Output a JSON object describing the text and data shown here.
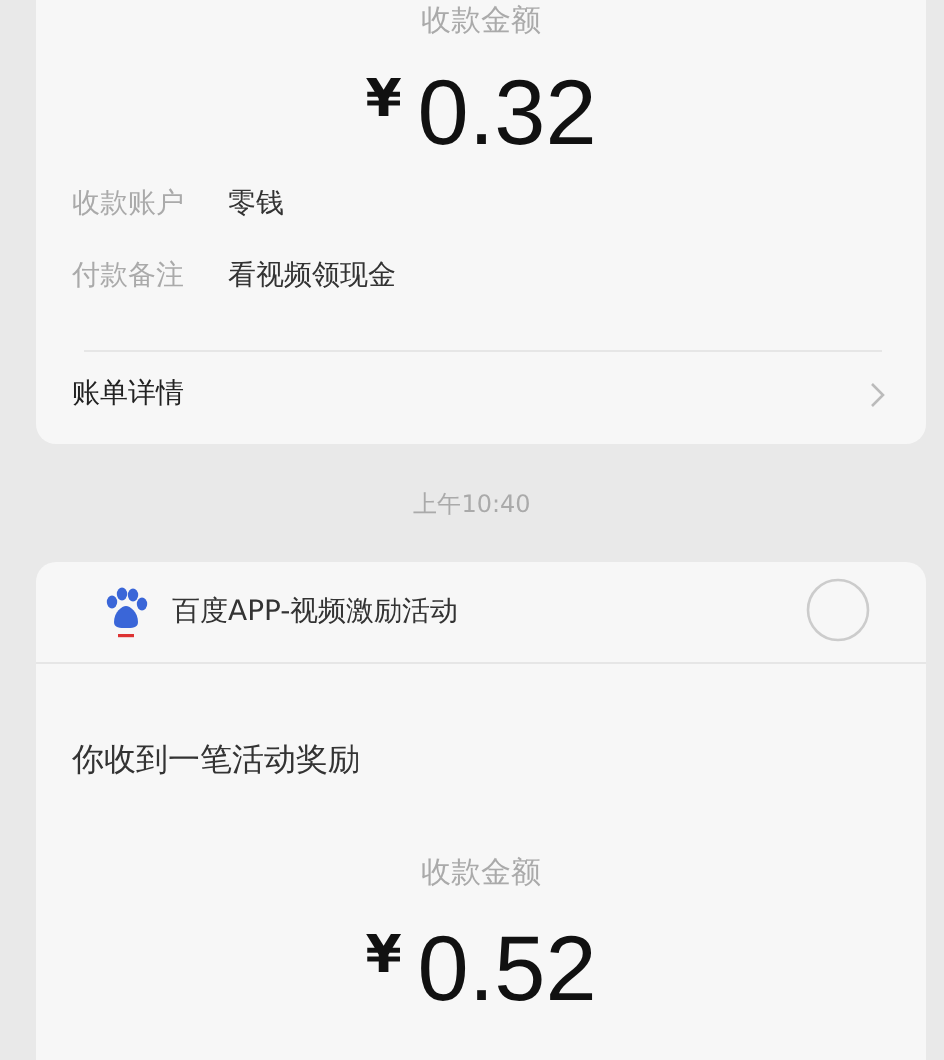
{
  "cards": [
    {
      "kind": "payment",
      "amount_label": "收款金额",
      "currency": "¥",
      "amount": "0.32",
      "details": [
        {
          "label": "收款账户",
          "value": "零钱"
        },
        {
          "label": "付款备注",
          "value": "看视频领现金"
        }
      ],
      "link": "账单详情"
    },
    {
      "kind": "notice",
      "time": "上午10:40",
      "sender": "百度APP-视频激励活动",
      "message": "你收到一笔活动奖励",
      "amount_label": "收款金额",
      "currency": "¥",
      "amount": "0.52"
    }
  ]
}
